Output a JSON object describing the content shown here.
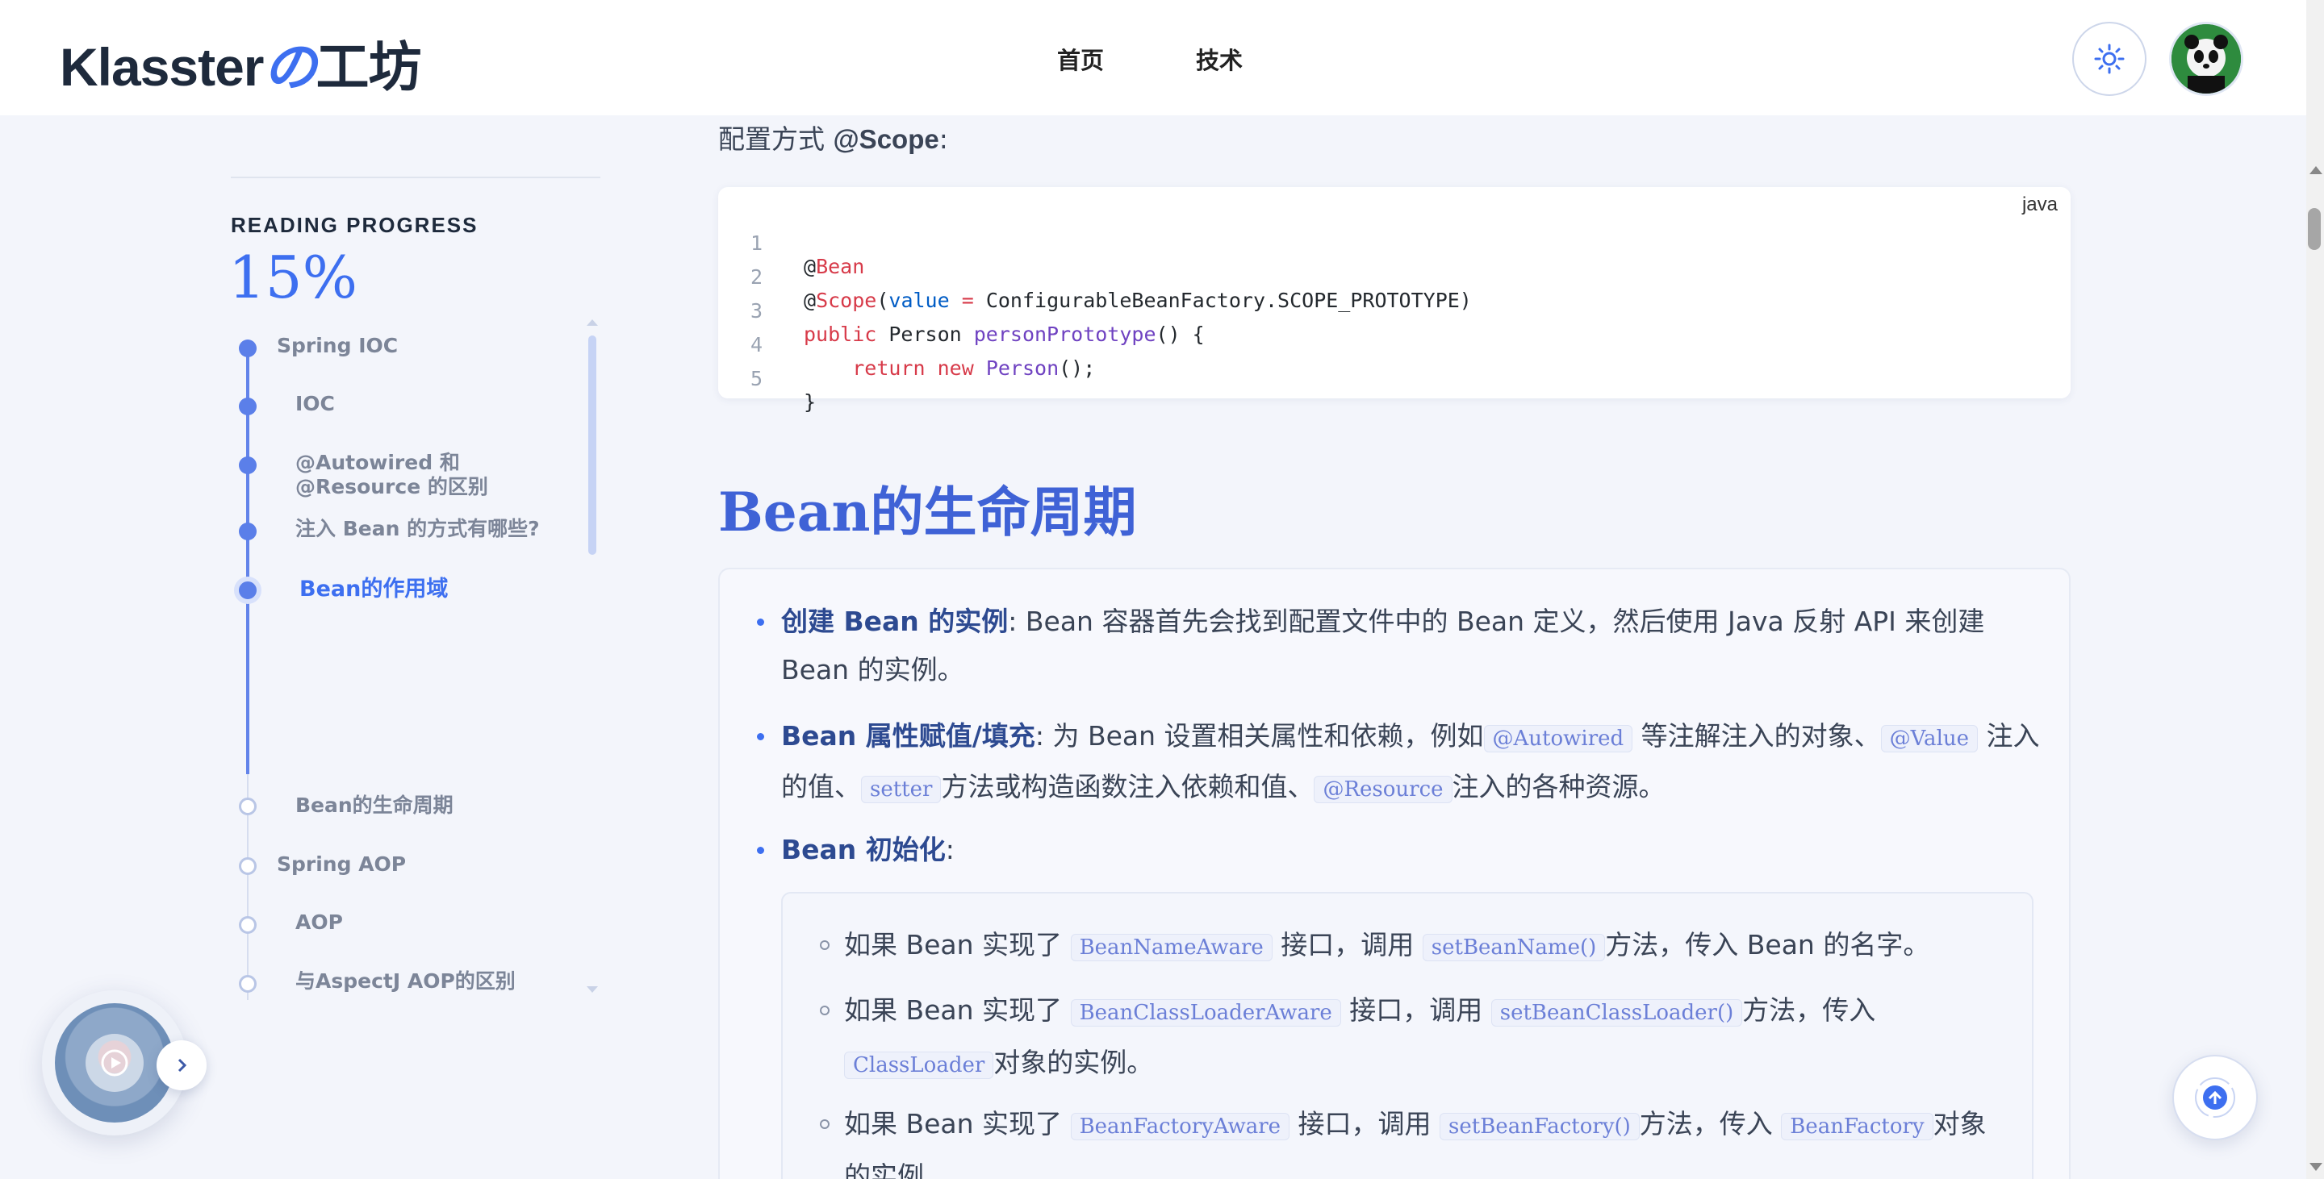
{
  "header": {
    "logo_main": "Klasster",
    "logo_accent": "の",
    "logo_tail": "工坊",
    "nav": [
      "首页",
      "技术"
    ]
  },
  "sidebar": {
    "progress_label": "READING PROGRESS",
    "progress_value": "15%",
    "toc": [
      {
        "label": "Spring IOC",
        "level": 1,
        "state": "done"
      },
      {
        "label": "IOC",
        "level": 2,
        "state": "done"
      },
      {
        "label": "@Autowired 和 @Resource 的区别",
        "level": 2,
        "state": "done"
      },
      {
        "label": "注入 Bean 的方式有哪些?",
        "level": 2,
        "state": "done"
      },
      {
        "label": "Bean的作用域",
        "level": 2,
        "state": "active"
      },
      {
        "label": "Bean的生命周期",
        "level": 2,
        "state": "todo"
      },
      {
        "label": "Spring AOP",
        "level": 1,
        "state": "todo"
      },
      {
        "label": "AOP",
        "level": 2,
        "state": "todo"
      },
      {
        "label": "与AspectJ AOP的区别",
        "level": 2,
        "state": "todo"
      }
    ]
  },
  "content": {
    "config_prefix": "配置方式 ",
    "config_annotation": "@Scope",
    "config_suffix": ":",
    "code": {
      "lang": "java",
      "line_numbers": [
        "1",
        "2",
        "3",
        "4",
        "5"
      ],
      "l1_at": "@",
      "l1_kw": "Bean",
      "l2_at": "@",
      "l2_kw": "Scope",
      "l2_paren": "(",
      "l2_attr": "value",
      "l2_eq": " = ",
      "l2_rest": "ConfigurableBeanFactory.SCOPE_PROTOTYPE)",
      "l3_kw": "public",
      "l3_type": " Person ",
      "l3_fn": "personPrototype",
      "l3_rest": "() {",
      "l4_indent": "    ",
      "l4_kw1": "return",
      "l4_sp": " ",
      "l4_kw2": "new",
      "l4_sp2": " ",
      "l4_fn": "Person",
      "l4_rest": "();",
      "l5": "}"
    },
    "heading": "Bean的生命周期",
    "items": {
      "i1_title": "创建 Bean 的实例",
      "i1_text": ": Bean 容器首先会找到配置文件中的 Bean 定义，然后使用 Java 反射 API 来创建 Bean 的实例。",
      "i2_title": "Bean 属性赋值/填充",
      "i2_t1": ": 为 Bean 设置相关属性和依赖，例如",
      "i2_c1": "@Autowired",
      "i2_t2": " 等注解注入的对象、",
      "i2_c2": "@Value",
      "i2_t3": " 注入的值、",
      "i2_c3": "setter",
      "i2_t4": "方法或构造函数注入依赖和值、",
      "i2_c4": "@Resource",
      "i2_t5": "注入的各种资源。",
      "i3_title": "Bean 初始化",
      "i3_text": ":"
    },
    "sub_items": {
      "s1_t1": "如果 Bean 实现了 ",
      "s1_c1": "BeanNameAware",
      "s1_t2": " 接口，调用 ",
      "s1_c2": "setBeanName()",
      "s1_t3": "方法，传入 Bean 的名字。",
      "s2_t1": "如果 Bean 实现了 ",
      "s2_c1": "BeanClassLoaderAware",
      "s2_t2": " 接口，调用 ",
      "s2_c2": "setBeanClassLoader()",
      "s2_t3": "方法，传入 ",
      "s2_c3": "ClassLoader",
      "s2_t4": "对象的实例。",
      "s3_t1": "如果 Bean 实现了 ",
      "s3_c1": "BeanFactoryAware",
      "s3_t2": " 接口，调用 ",
      "s3_c2": "setBeanFactory()",
      "s3_t3": "方法，传入 ",
      "s3_c3": "BeanFactory",
      "s3_t4": "对象的实例。"
    }
  },
  "colors": {
    "accent": "#3d6ff0",
    "heading": "#3f62d6",
    "background": "#f3f5fb"
  },
  "icons": {
    "theme": "sun-icon",
    "to_top": "arrow-up-icon",
    "player_play": "play-icon",
    "player_next": "chevron-right-icon"
  }
}
